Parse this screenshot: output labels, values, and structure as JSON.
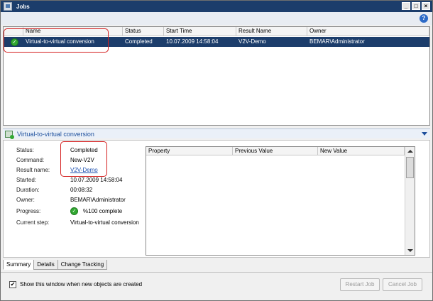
{
  "window": {
    "title": "Jobs",
    "buttons": {
      "minimize": "_",
      "maximize": "□",
      "close": "×"
    },
    "help_label": "?"
  },
  "jobs": {
    "columns": [
      "",
      "Name",
      "Status",
      "Start Time",
      "Result Name",
      "Owner"
    ],
    "rows": [
      {
        "name": "Virtual-to-virtual conversion",
        "status": "Completed",
        "start_time": "10.07.2009 14:58:04",
        "result_name": "V2V-Demo",
        "owner": "BEMAR\\Administrator"
      }
    ]
  },
  "details": {
    "title": "Virtual-to-virtual conversion",
    "props": {
      "status_label": "Status:",
      "status_value": "Completed",
      "command_label": "Command:",
      "command_value": "New-V2V",
      "result_label": "Result name:",
      "result_value": "V2V-Demo",
      "started_label": "Started:",
      "started_value": "10.07.2009 14:58:04",
      "duration_label": "Duration:",
      "duration_value": "00:08:32",
      "owner_label": "Owner:",
      "owner_value": "BEMAR\\Administrator",
      "progress_label": "Progress:",
      "progress_value": "%100 complete",
      "step_label": "Current step:",
      "step_value": "Virtual-to-virtual conversion"
    },
    "changes_columns": [
      "Property",
      "Previous Value",
      "New Value"
    ]
  },
  "tabs": [
    "Summary",
    "Details",
    "Change Tracking"
  ],
  "footer": {
    "checkbox_label": "Show this window when new objects are created",
    "checkbox_mark": "✔",
    "restart_button": "Restart Job",
    "cancel_button": "Cancel Job"
  },
  "colors": {
    "titlebar": "#1c3d6b",
    "selected_row": "#1c3d6b",
    "annotation": "#d42020",
    "status_ok": "#32a832",
    "link": "#1a4fb0"
  },
  "icons": [
    "app-window-icon",
    "help-icon",
    "completed-check-icon",
    "job-details-icon",
    "collapse-chevron-icon"
  ]
}
